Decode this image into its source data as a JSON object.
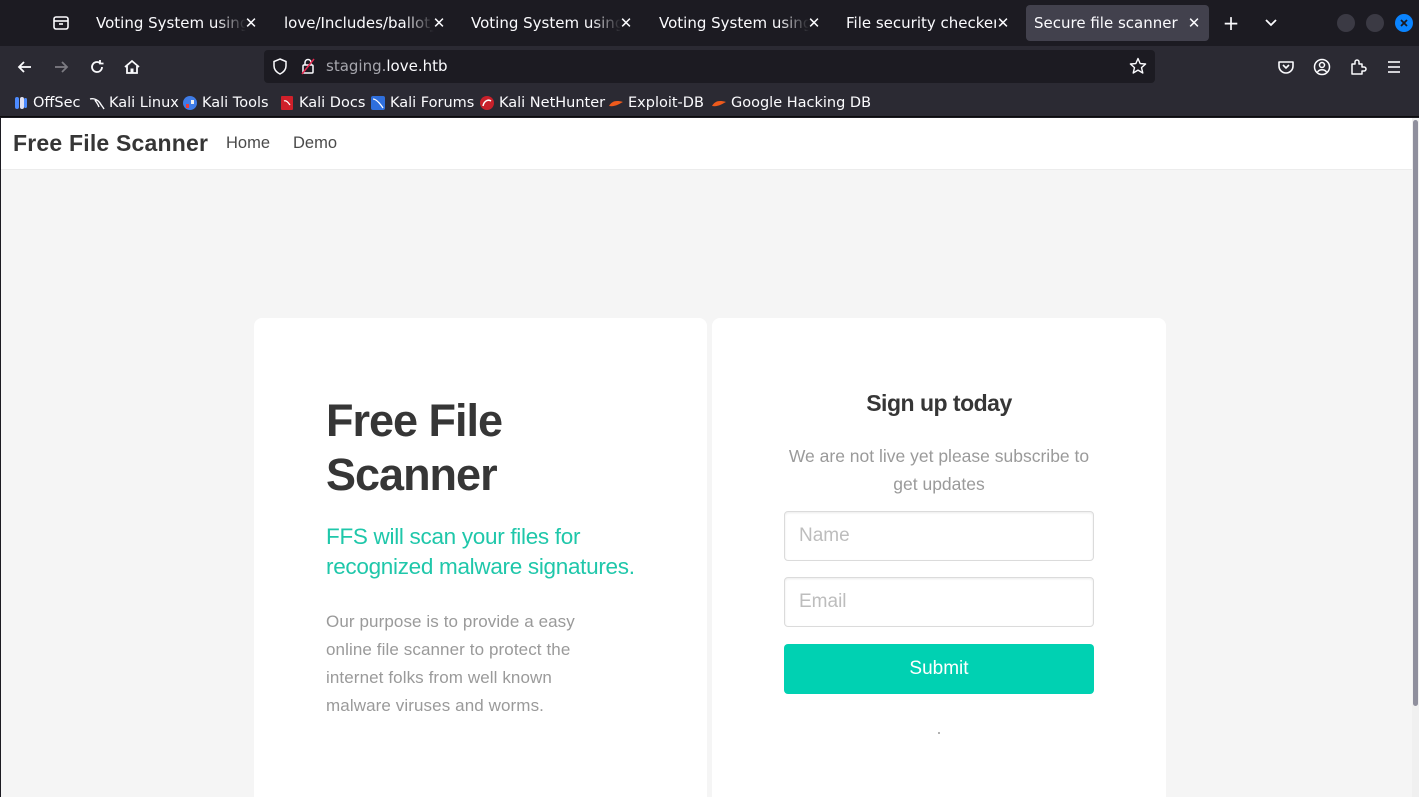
{
  "browser": {
    "tabs": [
      {
        "title": "Voting System using PHP",
        "active": false
      },
      {
        "title": "love/Includes/ballot_modal.php",
        "active": false
      },
      {
        "title": "Voting System using PHP",
        "active": false
      },
      {
        "title": "Voting System using PHP",
        "active": false
      },
      {
        "title": "File security checker",
        "active": false
      },
      {
        "title": "Secure file scanner",
        "active": true
      }
    ],
    "url": {
      "prefix": "staging.",
      "domain": "love.htb"
    },
    "bookmarks": [
      {
        "label": "OffSec",
        "icon": "offsec-icon"
      },
      {
        "label": "Kali Linux",
        "icon": "kali-dragon-icon"
      },
      {
        "label": "Kali Tools",
        "icon": "kali-tools-icon"
      },
      {
        "label": "Kali Docs",
        "icon": "kali-docs-icon"
      },
      {
        "label": "Kali Forums",
        "icon": "kali-forums-icon"
      },
      {
        "label": "Kali NetHunter",
        "icon": "nethunter-icon"
      },
      {
        "label": "Exploit-DB",
        "icon": "exploit-db-icon"
      },
      {
        "label": "Google Hacking DB",
        "icon": "ghdb-icon"
      }
    ],
    "colors": {
      "chrome_dark": "#1c1b22",
      "toolbar": "#2b2a33",
      "active_tab": "#42414d",
      "close_button": "#0a84ff"
    }
  },
  "site": {
    "brand": "Free File Scanner",
    "nav": {
      "home": "Home",
      "demo": "Demo"
    },
    "hero": {
      "title": "Free File Scanner",
      "subtitle": "FFS will scan your files for recognized malware signatures.",
      "body": "Our purpose is to provide a easy online file scanner to protect the internet folks from well known malware viruses and worms."
    },
    "signup": {
      "title": "Sign up today",
      "description": "We are not live yet please subscribe to get updates",
      "name_placeholder": "Name",
      "email_placeholder": "Email",
      "submit_label": "Submit"
    },
    "colors": {
      "accent": "#00d1b2",
      "subtitle": "#1fc7aa",
      "heading": "#363636",
      "muted": "#9a9a9a"
    }
  }
}
